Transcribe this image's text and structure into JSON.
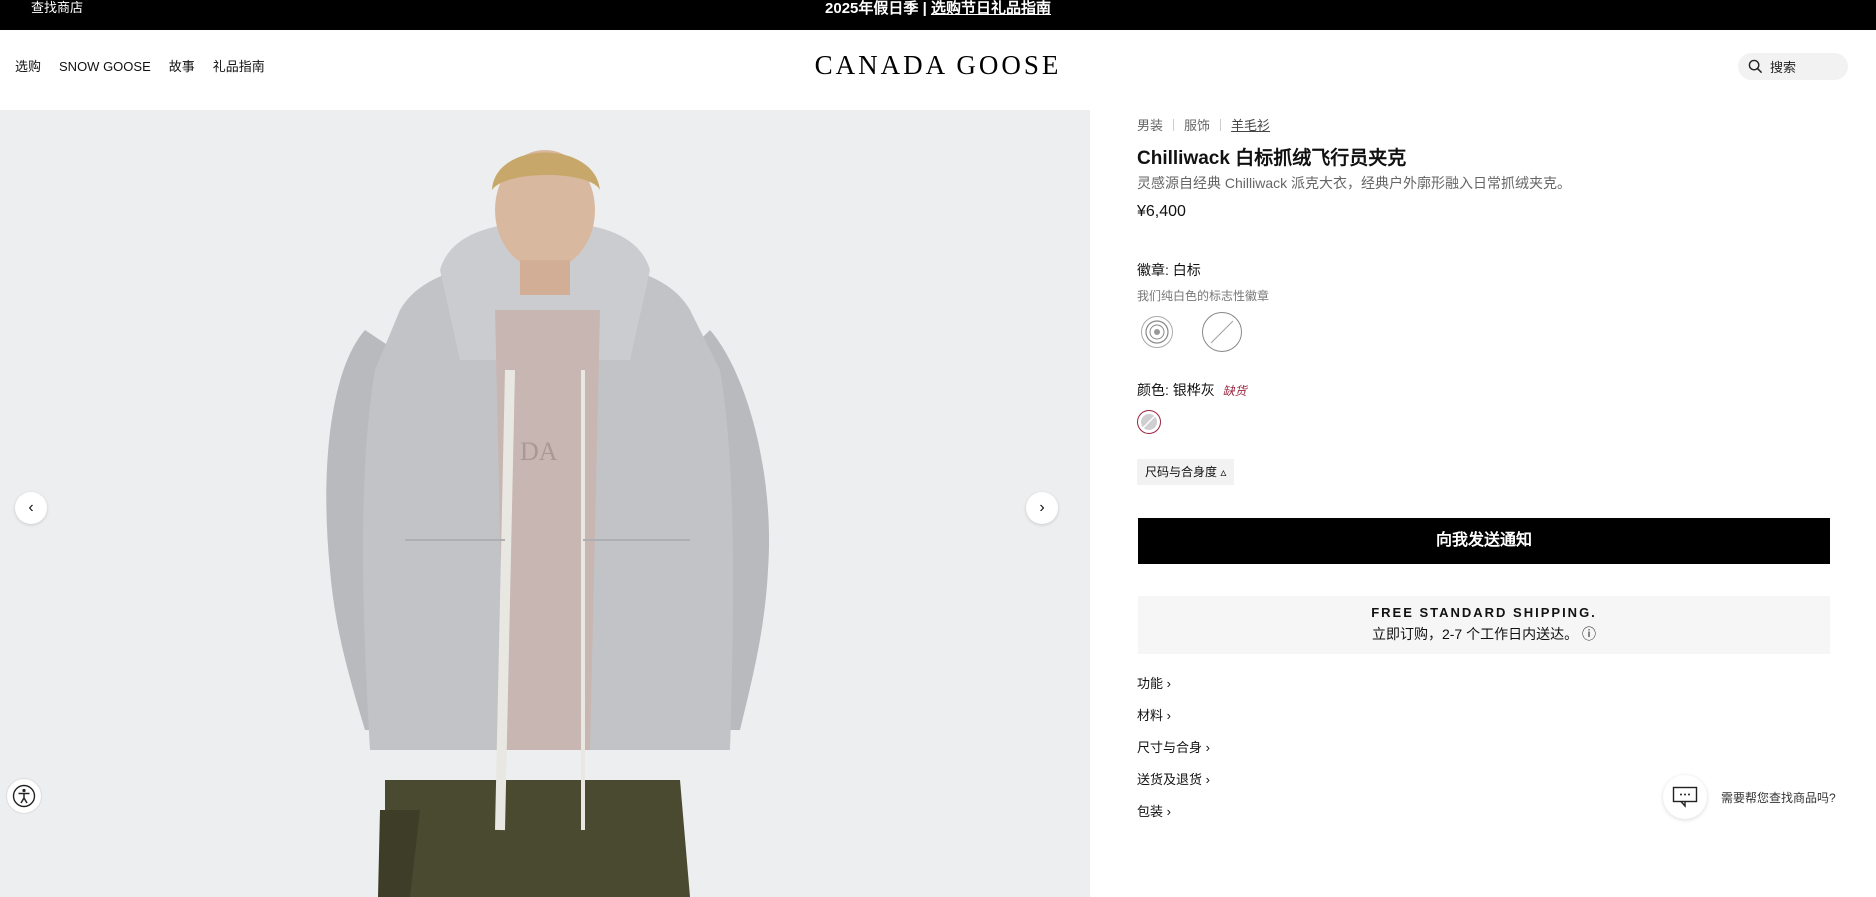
{
  "announcement": {
    "store_locator": "查找商店",
    "promo_prefix": "2025年假日季 | ",
    "promo_link": "选购节日礼品指南"
  },
  "header": {
    "nav": [
      "选购",
      "SNOW GOOSE",
      "故事",
      "礼品指南"
    ],
    "logo": "CANADA GOOSE",
    "search_label": "搜索"
  },
  "gallery": {
    "prev_icon": "chevron-left-icon",
    "next_icon": "chevron-right-icon",
    "prev_glyph": "‹",
    "next_glyph": "›",
    "image_description_icon": "product-photo"
  },
  "product": {
    "breadcrumb": [
      "男装",
      "服饰",
      "羊毛衫"
    ],
    "title": "Chilliwack 白标抓绒飞行员夹克",
    "subtitle": "灵感源自经典 Chilliwack 派克大衣，经典户外廓形融入日常抓绒夹克。",
    "price": "¥6,400",
    "badge_label": "徽章:",
    "badge_value": "白标",
    "badge_desc": "我们纯白色的标志性徽章",
    "color_label": "颜色:",
    "color_value": "银桦灰",
    "color_status": "缺货",
    "size_guide": "尺码与合身度",
    "notify_button": "向我发送通知",
    "shipping_title": "FREE STANDARD SHIPPING.",
    "shipping_sub": "立即订购，2-7 个工作日内送达。",
    "accordion": [
      "功能",
      "材料",
      "尺寸与合身",
      "送货及退货",
      "包装"
    ]
  },
  "chat": {
    "text": "需要帮您查找商品吗?"
  },
  "colors": {
    "accent_oos": "#9a2540",
    "button_bg": "#000000",
    "gallery_bg": "#eceeef"
  }
}
